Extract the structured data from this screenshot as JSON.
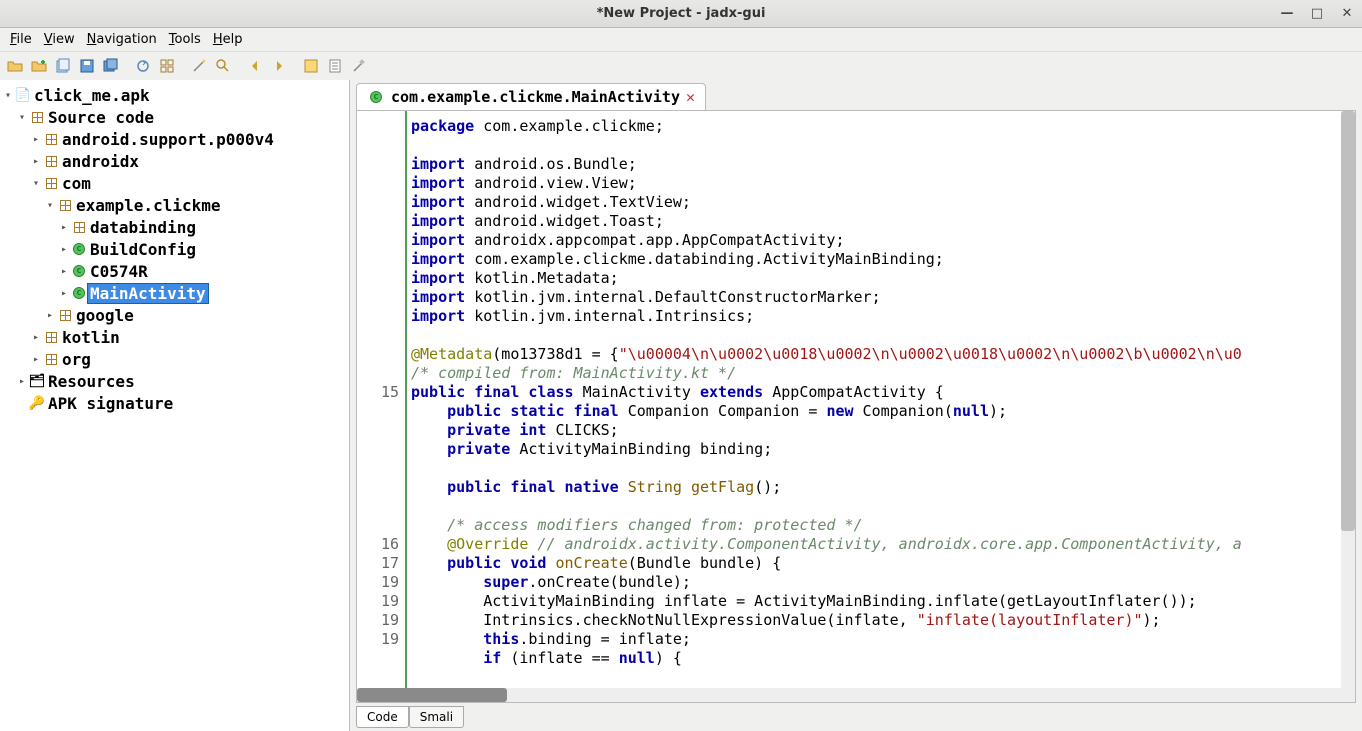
{
  "window": {
    "title": "*New Project - jadx-gui"
  },
  "menubar": {
    "file": "File",
    "view": "View",
    "navigation": "Navigation",
    "tools": "Tools",
    "help": "Help"
  },
  "tree": {
    "root": "click_me.apk",
    "source_code": "Source code",
    "pkg_android_support": "android.support.p000v4",
    "pkg_androidx": "androidx",
    "pkg_com": "com",
    "pkg_example_clickme": "example.clickme",
    "pkg_databinding": "databinding",
    "cls_buildconfig": "BuildConfig",
    "cls_c0574r": "C0574R",
    "cls_mainactivity": "MainActivity",
    "pkg_google": "google",
    "pkg_kotlin": "kotlin",
    "pkg_org": "org",
    "resources": "Resources",
    "apk_signature": "APK signature"
  },
  "tab": {
    "title": "com.example.clickme.MainActivity"
  },
  "gutter_lines": [
    "",
    "",
    "",
    "",
    "",
    "",
    "",
    "",
    "",
    "",
    "",
    "",
    "",
    "",
    "15",
    "",
    "",
    "",
    "",
    "",
    "",
    "",
    "16",
    "17",
    "19",
    "19",
    "19",
    "19"
  ],
  "code": {
    "l1": "package com.example.clickme;",
    "l2": "",
    "l3_1": "import",
    "l3_2": " android.os.Bundle;",
    "l4_1": "import",
    "l4_2": " android.view.View;",
    "l5_1": "import",
    "l5_2": " android.widget.TextView;",
    "l6_1": "import",
    "l6_2": " android.widget.Toast;",
    "l7_1": "import",
    "l7_2": " androidx.appcompat.app.AppCompatActivity;",
    "l8_1": "import",
    "l8_2": " com.example.clickme.databinding.ActivityMainBinding;",
    "l9_1": "import",
    "l9_2": " kotlin.Metadata;",
    "l10_1": "import",
    "l10_2": " kotlin.jvm.internal.DefaultConstructorMarker;",
    "l11_1": "import",
    "l11_2": " kotlin.jvm.internal.Intrinsics;",
    "l12": "",
    "l13_1": "@Metadata",
    "l13_2": "(mo13738d1 = {",
    "l13_3": "\"\\u00004\\n\\u0002\\u0018\\u0002\\n\\u0002\\u0018\\u0002\\n\\u0002\\b\\u0002\\n\\u0",
    "l14": "/* compiled from: MainActivity.kt */",
    "l15_1": "public final class",
    "l15_2": " MainActivity ",
    "l15_3": "extends",
    "l15_4": " AppCompatActivity {",
    "l16_1": "    public static final",
    "l16_2": " Companion Companion = ",
    "l16_3": "new",
    "l16_4": " Companion(",
    "l16_5": "null",
    "l16_6": ");",
    "l17_1": "    private int",
    "l17_2": " CLICKS;",
    "l18_1": "    private",
    "l18_2": " ActivityMainBinding binding;",
    "l19": "",
    "l20_1": "    public final native ",
    "l20_2": "String",
    "l20_3": " getFlag",
    "l20_4": "();",
    "l21": "",
    "l22": "    /* access modifiers changed from: protected */",
    "l23_1": "    @Override",
    "l23_2": " // androidx.activity.ComponentActivity, androidx.core.app.ComponentActivity, a",
    "l24_1": "    public void ",
    "l24_2": "onCreate",
    "l24_3": "(Bundle bundle) {",
    "l25_1": "        super",
    "l25_2": ".onCreate(bundle);",
    "l26": "        ActivityMainBinding inflate = ActivityMainBinding.inflate(getLayoutInflater());",
    "l27_1": "        Intrinsics.checkNotNullExpressionValue(inflate, ",
    "l27_2": "\"inflate(layoutInflater)\"",
    "l27_3": ");",
    "l28_1": "        this",
    "l28_2": ".binding = inflate;",
    "l29_1": "        if",
    "l29_2": " (inflate == ",
    "l29_3": "null",
    "l29_4": ") {"
  },
  "bottom_tabs": {
    "code": "Code",
    "smali": "Smali"
  }
}
